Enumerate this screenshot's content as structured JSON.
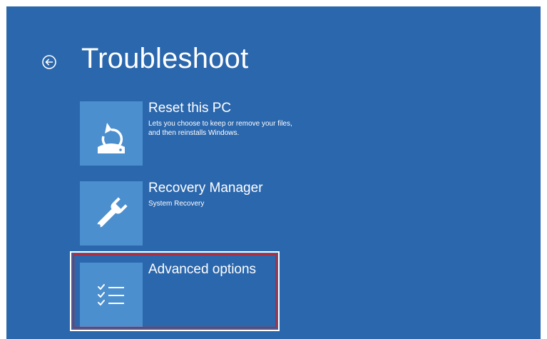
{
  "header": {
    "title": "Troubleshoot",
    "back_icon": "back-arrow-circle-icon"
  },
  "options": [
    {
      "title": "Reset this PC",
      "description": "Lets you choose to keep or remove your files, and then reinstalls Windows.",
      "icon": "reset-icon"
    },
    {
      "title": "Recovery Manager",
      "description": "System Recovery",
      "icon": "wrench-icon"
    },
    {
      "title": "Advanced options",
      "description": "",
      "icon": "checklist-icon",
      "highlighted": true
    }
  ],
  "colors": {
    "background": "#2b67ad",
    "tile": "#4b8fcf",
    "highlight_border": "#c0262e",
    "text": "#ffffff"
  }
}
